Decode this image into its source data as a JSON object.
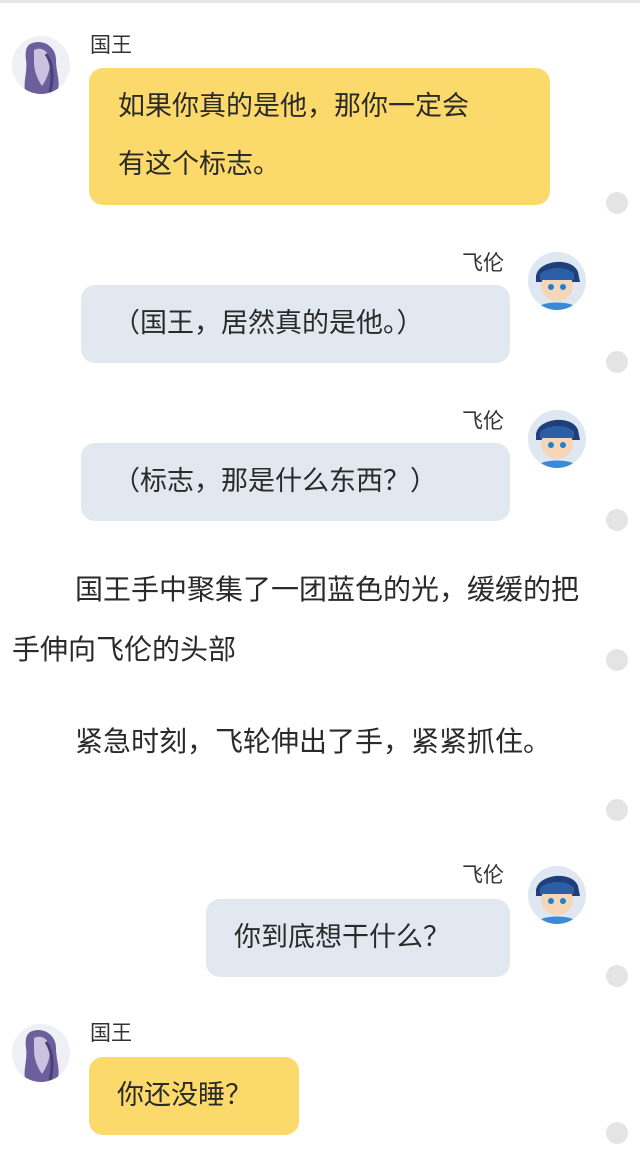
{
  "messages": [
    {
      "speaker": "国王",
      "line1": "如果你真的是他，那你一定会",
      "line2": "有这个标志。"
    },
    {
      "speaker": "飞伦",
      "text": "（国王，居然真的是他。）"
    },
    {
      "speaker": "飞伦",
      "text": "（标志，那是什么东西？）"
    },
    {
      "speaker": "飞伦",
      "text": "你到底想干什么？"
    },
    {
      "speaker": "国王",
      "text": "你还没睡？"
    }
  ],
  "narration": [
    "国王手中聚集了一团蓝色的光，缓缓的把手伸向飞伦的头部",
    "紧急时刻，飞轮伸出了手，紧紧抓住。"
  ],
  "colors": {
    "king_bubble": "#fcd96b",
    "feilun_bubble": "#e1e8f0",
    "dot": "#e4e4e4"
  }
}
